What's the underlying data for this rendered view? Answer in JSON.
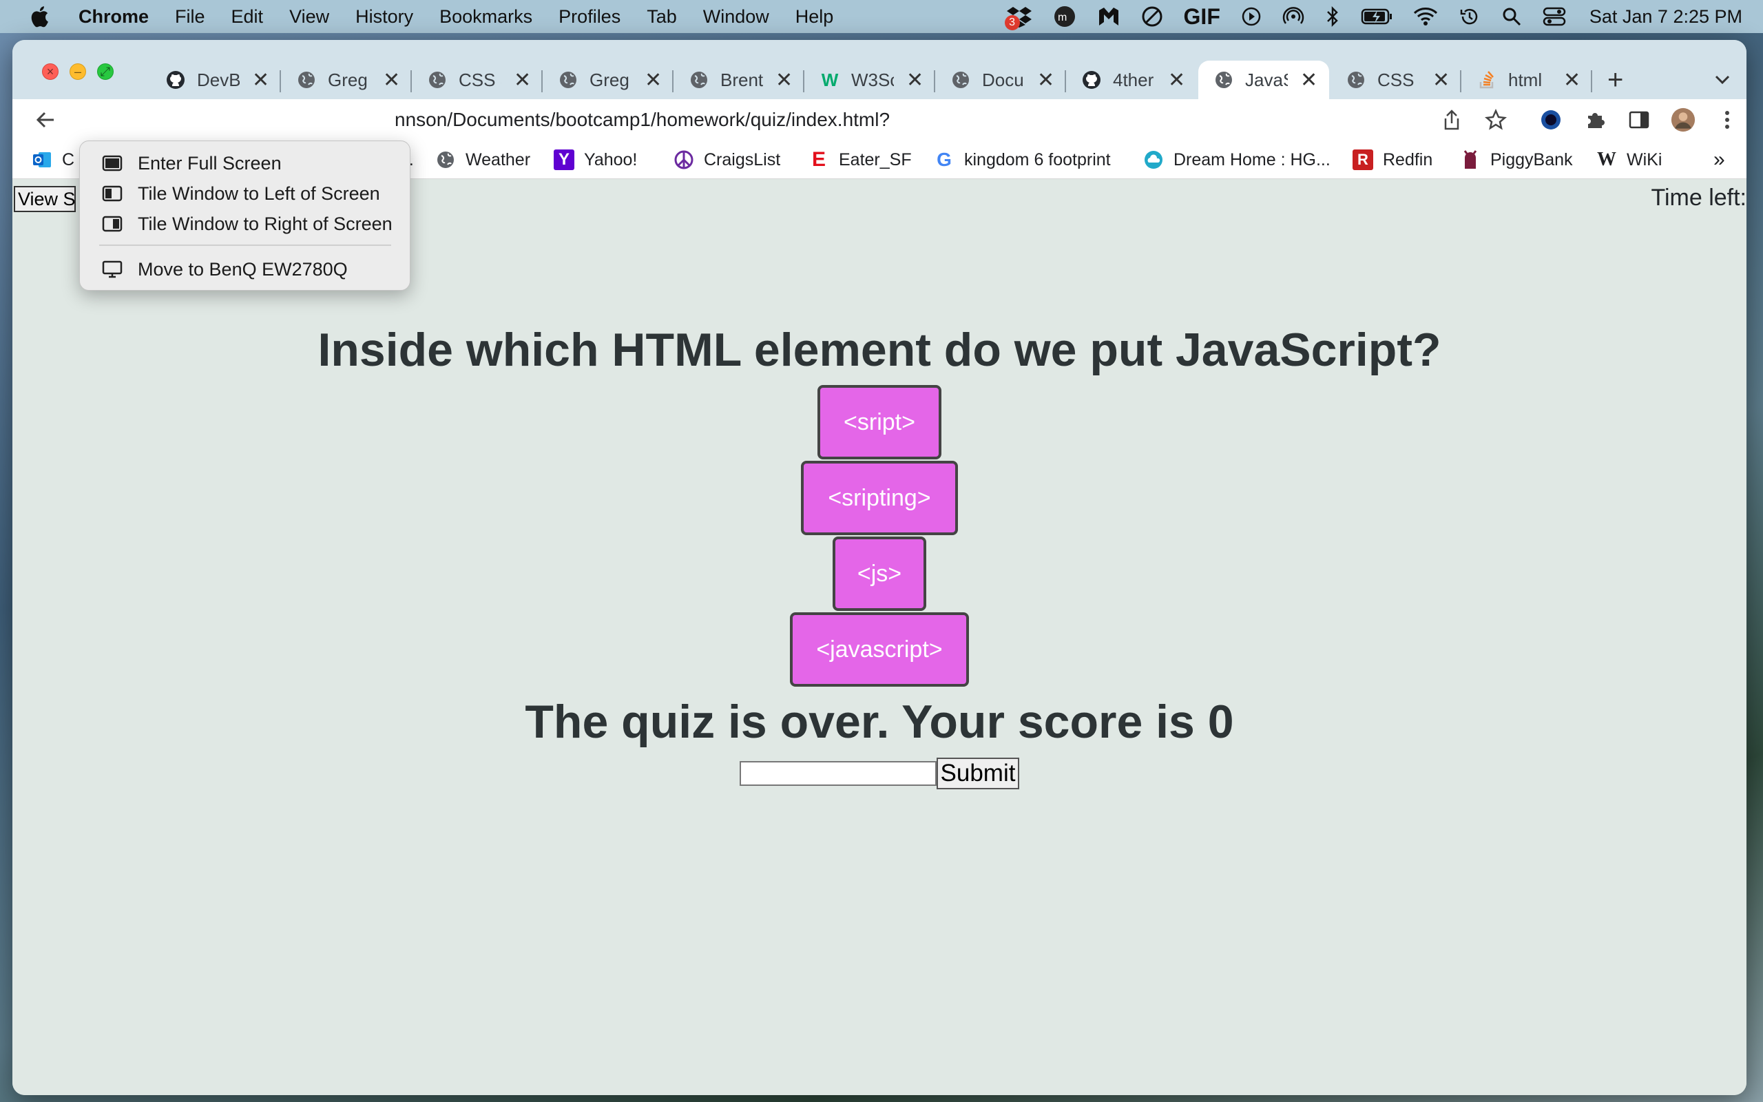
{
  "menubar": {
    "app_name": "Chrome",
    "items": [
      "File",
      "Edit",
      "View",
      "History",
      "Bookmarks",
      "Profiles",
      "Tab",
      "Window",
      "Help"
    ],
    "badge_count": "3",
    "clock": "Sat Jan 7  2:25 PM",
    "status_icons": [
      "dropbox-icon",
      "mm-icon",
      "malwarebytes-icon",
      "no-entry-icon",
      "gif-icon",
      "play-icon",
      "airdrop-icon",
      "bluetooth-icon",
      "battery-icon",
      "wifi-icon",
      "time-machine-icon",
      "search-icon",
      "control-center-icon"
    ]
  },
  "tabs": [
    {
      "label": "DevB",
      "icon": "github-icon",
      "active": false
    },
    {
      "label": "Greg",
      "icon": "globe-icon",
      "active": false
    },
    {
      "label": "CSS S",
      "icon": "globe-icon",
      "active": false
    },
    {
      "label": "Greg",
      "icon": "globe-icon",
      "active": false
    },
    {
      "label": "Brent",
      "icon": "globe-icon",
      "active": false
    },
    {
      "label": "W3Sc",
      "icon": "w3schools-icon",
      "active": false
    },
    {
      "label": "Docu",
      "icon": "globe-icon",
      "active": false
    },
    {
      "label": "4ther",
      "icon": "github-icon",
      "active": false
    },
    {
      "label": "JavaS",
      "icon": "globe-icon",
      "active": true
    },
    {
      "label": "CSS S",
      "icon": "globe-icon",
      "active": false
    },
    {
      "label": "html",
      "icon": "stackoverflow-icon",
      "active": false
    }
  ],
  "address": {
    "url": "nnson/Documents/bootcamp1/homework/quiz/index.html?"
  },
  "bookmarks": [
    {
      "label": "C",
      "icon": "outlook-icon"
    },
    {
      "label": "...",
      "icon": ""
    },
    {
      "label": "Weather",
      "icon": "globe-icon"
    },
    {
      "label": "Yahoo!",
      "icon": "yahoo-icon"
    },
    {
      "label": "CraigsList",
      "icon": "peace-icon"
    },
    {
      "label": "Eater_SF",
      "icon": "eater-icon"
    },
    {
      "label": "kingdom 6 footprint",
      "icon": "google-icon"
    },
    {
      "label": "Dream Home : HG...",
      "icon": "cloud-icon"
    },
    {
      "label": "Redfin",
      "icon": "redfin-icon"
    },
    {
      "label": "PiggyBank",
      "icon": "piggy-icon"
    },
    {
      "label": "WiKi",
      "icon": "wikipedia-icon"
    }
  ],
  "bookmarks_overflow": "»",
  "window_menu": {
    "items": [
      "Enter Full Screen",
      "Tile Window to Left of Screen",
      "Tile Window to Right of Screen",
      "Move to BenQ EW2780Q"
    ]
  },
  "page": {
    "view_scores_label": "View Scores",
    "time_left_label": "Time left:",
    "question": "Inside which HTML element do we put JavaScript?",
    "answers": [
      "<sript>",
      "<sripting>",
      "<js>",
      "<javascript>"
    ],
    "result": "The quiz is over. Your score is 0",
    "initials_value": "",
    "submit_label": "Submit",
    "answer_color": "#e466e8"
  }
}
